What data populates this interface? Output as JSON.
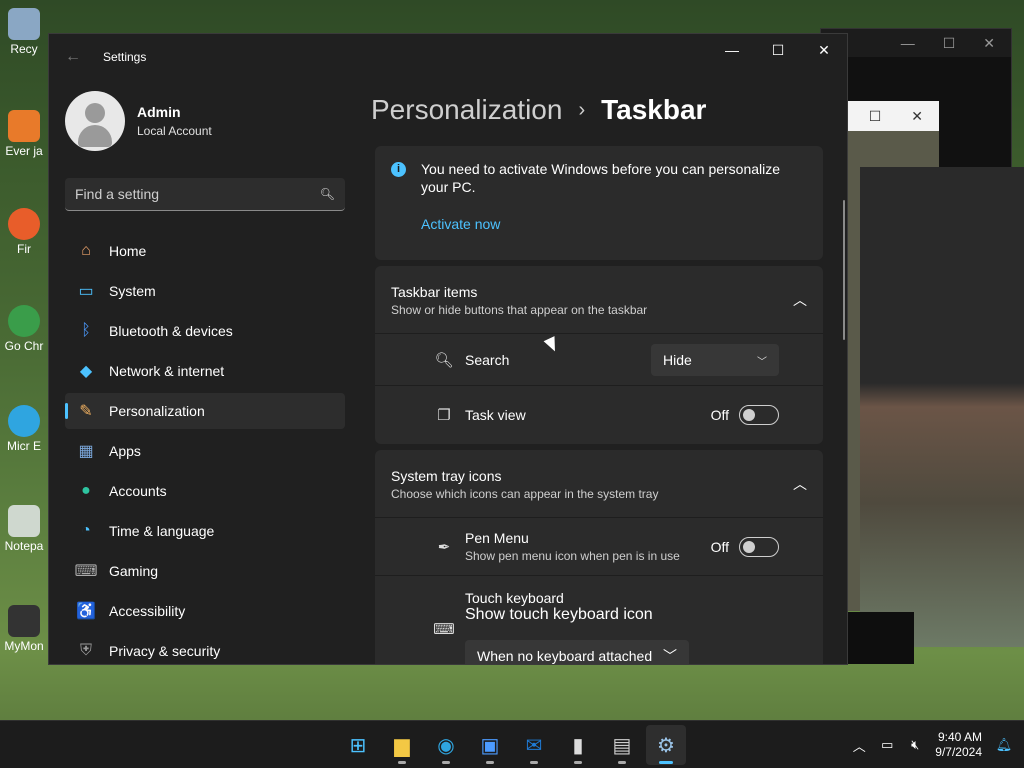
{
  "desktop": {
    "icons": [
      "Recy",
      "Ever ja",
      "Fir",
      "Go Chr",
      "Micr E",
      "Notepa",
      "MyMon"
    ]
  },
  "window": {
    "title": "Settings",
    "back_icon": "back-arrow-icon",
    "minimize": "—",
    "maximize": "☐",
    "close": "✕"
  },
  "profile": {
    "name": "Admin",
    "account": "Local Account"
  },
  "search": {
    "placeholder": "Find a setting"
  },
  "sidebar": {
    "items": [
      {
        "label": "Home",
        "icon": "home-icon",
        "glyph": "⌂",
        "color": "#e8a06a"
      },
      {
        "label": "System",
        "icon": "system-icon",
        "glyph": "▭",
        "color": "#4cc2ff"
      },
      {
        "label": "Bluetooth & devices",
        "icon": "bluetooth-icon",
        "glyph": "ᛒ",
        "color": "#4c9bff"
      },
      {
        "label": "Network & internet",
        "icon": "wifi-icon",
        "glyph": "◆",
        "color": "#4cc2ff"
      },
      {
        "label": "Personalization",
        "icon": "brush-icon",
        "glyph": "✎",
        "color": "#f0b060"
      },
      {
        "label": "Apps",
        "icon": "apps-icon",
        "glyph": "▦",
        "color": "#7aa6d9"
      },
      {
        "label": "Accounts",
        "icon": "accounts-icon",
        "glyph": "●",
        "color": "#2ec4a0"
      },
      {
        "label": "Time & language",
        "icon": "globe-clock-icon",
        "glyph": "◔",
        "color": "#4cc2ff"
      },
      {
        "label": "Gaming",
        "icon": "gamepad-icon",
        "glyph": "⌨",
        "color": "#aaaaaa"
      },
      {
        "label": "Accessibility",
        "icon": "accessibility-icon",
        "glyph": "♿",
        "color": "#4cc2ff"
      },
      {
        "label": "Privacy & security",
        "icon": "shield-icon",
        "glyph": "⛨",
        "color": "#9a9a9a"
      }
    ],
    "active_index": 4
  },
  "breadcrumb": {
    "parent": "Personalization",
    "separator": "›",
    "current": "Taskbar"
  },
  "activation": {
    "message": "You need to activate Windows before you can personalize your PC.",
    "link": "Activate now"
  },
  "taskbar_items": {
    "title": "Taskbar items",
    "subtitle": "Show or hide buttons that appear on the taskbar",
    "search": {
      "label": "Search",
      "value": "Hide"
    },
    "task_view": {
      "label": "Task view",
      "state": "Off"
    }
  },
  "system_tray": {
    "title": "System tray icons",
    "subtitle": "Choose which icons can appear in the system tray",
    "pen_menu": {
      "label": "Pen Menu",
      "subtitle": "Show pen menu icon when pen is in use",
      "state": "Off"
    },
    "touch_keyboard": {
      "label": "Touch keyboard",
      "subtitle": "Show touch keyboard icon",
      "value": "When no keyboard attached"
    }
  },
  "taskbar": {
    "apps": [
      {
        "name": "start-icon",
        "color": "#4cc2ff"
      },
      {
        "name": "file-explorer-icon",
        "color": "#f3c844"
      },
      {
        "name": "edge-icon",
        "color": "#2fa5e0"
      },
      {
        "name": "store-icon",
        "color": "#4c9bff"
      },
      {
        "name": "outlook-icon",
        "color": "#1f7bd6"
      },
      {
        "name": "terminal-icon",
        "color": "#dddddd"
      },
      {
        "name": "installer-icon",
        "color": "#cfcfcf"
      },
      {
        "name": "settings-icon",
        "color": "#9bc4e8"
      }
    ],
    "time": "9:40 AM",
    "date": "9/7/2024"
  }
}
